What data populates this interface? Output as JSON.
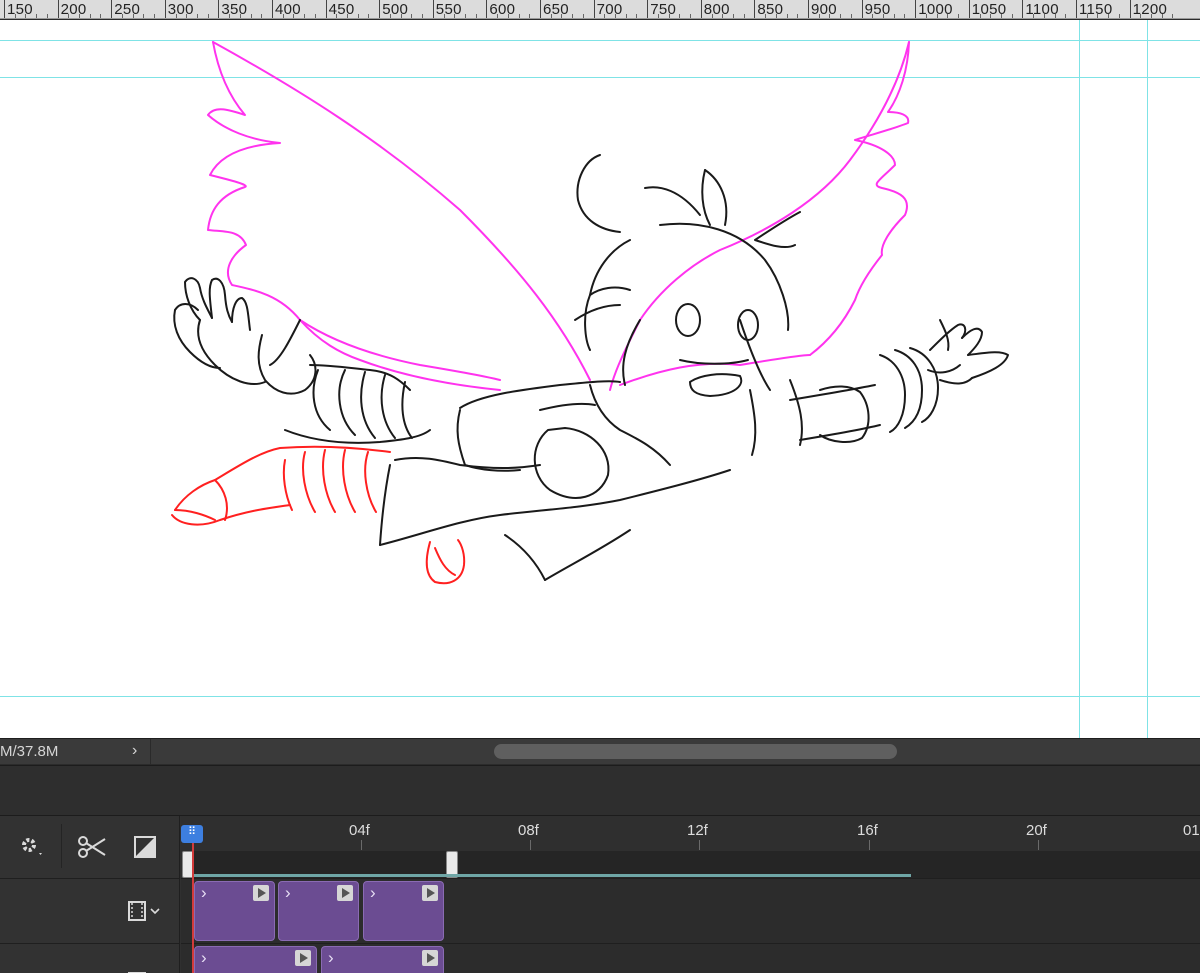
{
  "ruler": {
    "labels": [
      "150",
      "200",
      "250",
      "300",
      "350",
      "400",
      "450",
      "500",
      "550",
      "600",
      "650",
      "700",
      "750",
      "800",
      "850",
      "900",
      "950",
      "1000",
      "1050",
      "1100",
      "1150",
      "1200"
    ]
  },
  "status": {
    "doc_size": "M/37.8M",
    "arrow": "›"
  },
  "timeline": {
    "settings_icon": "gear-icon",
    "split_icon": "scissors-icon",
    "transition_icon": "transition-icon",
    "video_track_icon": "film-icon",
    "playhead_label": "⠿",
    "frame_labels": [
      "04f",
      "08f",
      "12f",
      "16f",
      "20f",
      "01"
    ],
    "track1_clips": 3,
    "track2_clips": 2
  },
  "colors": {
    "wings": "#ff33ee",
    "legs": "#ff2020",
    "lines": "#1a1a1a",
    "guides": "#7fe3e6",
    "clip": "#6b4c92",
    "playhead": "#3d7fe0"
  }
}
